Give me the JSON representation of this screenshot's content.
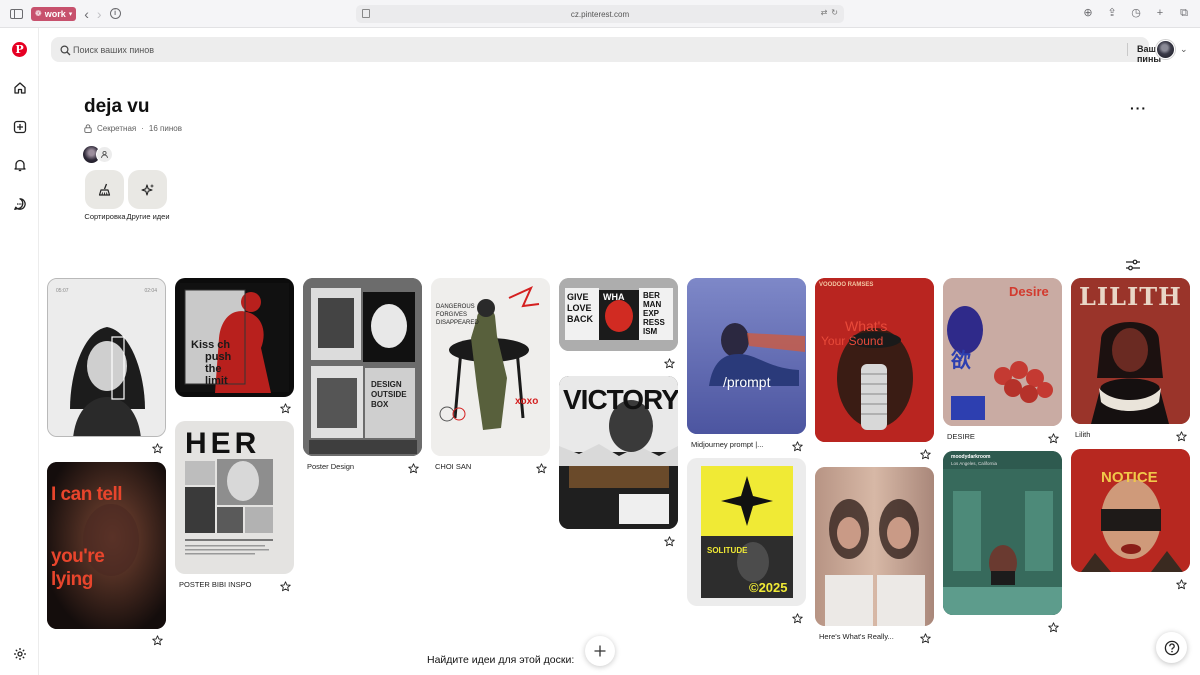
{
  "browser": {
    "profile_label": "work",
    "url": "cz.pinterest.com"
  },
  "search": {
    "placeholder": "Поиск ваших пинов",
    "scope_label": "Ваши пины"
  },
  "board": {
    "title": "deja vu",
    "privacy": "Секретная",
    "separator": "·",
    "pin_count": "16 пинов",
    "actions": [
      {
        "label": "Сортировка",
        "icon": "broom-icon"
      },
      {
        "label": "Другие идеи",
        "icon": "sparkles-icon"
      }
    ]
  },
  "pins": [
    {
      "caption": "",
      "art": {
        "text": [
          "05:07",
          "02:04"
        ]
      }
    },
    {
      "caption": "",
      "art": {
        "text": [
          "I can tell",
          "you're",
          "lying"
        ]
      }
    },
    {
      "caption": "",
      "art": {
        "text": [
          "Kiss ch",
          "push",
          "the",
          "limit"
        ]
      }
    },
    {
      "caption": "POSTER BIBI INSPO",
      "art": {
        "text": [
          "HER"
        ]
      }
    },
    {
      "caption": "Poster Design",
      "art": {
        "text": [
          "DESIGN",
          "OUTSIDE",
          "BOX"
        ]
      }
    },
    {
      "caption": "CHOI SAN",
      "art": {
        "text": [
          "DANGEROUS",
          "FORGIVES",
          "DISAPPEARED",
          "xoxo"
        ]
      }
    },
    {
      "caption": "",
      "art": {
        "text": [
          "GIVE",
          "LOVE",
          "BACK",
          "WHA",
          "BER",
          "MAN",
          "EXP",
          "RESS",
          "ISM"
        ]
      }
    },
    {
      "caption": "",
      "art": {
        "text": [
          "VICTORY"
        ]
      }
    },
    {
      "caption": "Midjourney prompt |...",
      "art": {
        "text": [
          "/prompt"
        ]
      }
    },
    {
      "caption": "",
      "art": {
        "text": [
          "SOLITUDE",
          "©2025"
        ]
      }
    },
    {
      "caption": "",
      "art": {
        "text": [
          "VOODOO RAMSES",
          "What's",
          "Your Sound"
        ]
      }
    },
    {
      "caption": "Here's What's Really...",
      "art": {
        "text": []
      }
    },
    {
      "caption": "DESIRE",
      "art": {
        "text": [
          "Desire",
          "欲"
        ]
      }
    },
    {
      "caption": "",
      "art": {
        "text": [
          "moodydarkroom",
          "Los Angeles, California"
        ]
      }
    },
    {
      "caption": "Lilith",
      "art": {
        "text": [
          "LILITH"
        ]
      }
    },
    {
      "caption": "",
      "art": {
        "text": [
          "NOTICE"
        ]
      }
    }
  ],
  "footer": {
    "ideas_label": "Найдите идеи для этой доски:"
  },
  "colors": {
    "pinterest_red": "#e60023",
    "profile_pill": "#c7516d",
    "tile_bg": "#e9e8e4"
  }
}
